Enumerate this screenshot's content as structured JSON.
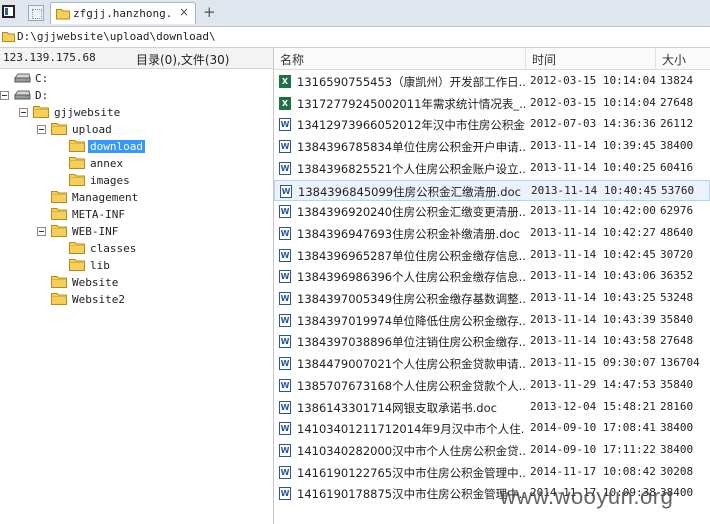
{
  "tab": {
    "title": "zfgjj.hanzhong.go...",
    "close": "×",
    "new": "+"
  },
  "address": {
    "path": "D:\\gjjwebsite\\upload\\download\\"
  },
  "status": {
    "ip": "123.139.175.68",
    "counts": "目录(0),文件(30)"
  },
  "tree": [
    {
      "label": "C:",
      "icon": "drive-icon",
      "toggle": false,
      "depth": 0
    },
    {
      "label": "D:",
      "icon": "drive-icon",
      "toggle": true,
      "depth": 0
    },
    {
      "label": "gjjwebsite",
      "icon": "folder-icon",
      "toggle": true,
      "depth": 1
    },
    {
      "label": "upload",
      "icon": "folder-icon",
      "toggle": true,
      "depth": 2
    },
    {
      "label": "download",
      "icon": "folder-icon",
      "toggle": false,
      "depth": 3,
      "selected": true
    },
    {
      "label": "annex",
      "icon": "folder-icon",
      "toggle": false,
      "depth": 3
    },
    {
      "label": "images",
      "icon": "folder-icon",
      "toggle": false,
      "depth": 3
    },
    {
      "label": "Management",
      "icon": "folder-icon",
      "toggle": false,
      "depth": 2
    },
    {
      "label": "META-INF",
      "icon": "folder-icon",
      "toggle": false,
      "depth": 2
    },
    {
      "label": "WEB-INF",
      "icon": "folder-icon",
      "toggle": true,
      "depth": 2
    },
    {
      "label": "classes",
      "icon": "folder-icon",
      "toggle": false,
      "depth": 3
    },
    {
      "label": "lib",
      "icon": "folder-icon",
      "toggle": false,
      "depth": 3
    },
    {
      "label": "Website",
      "icon": "folder-icon",
      "toggle": false,
      "depth": 2
    },
    {
      "label": "Website2",
      "icon": "folder-icon",
      "toggle": false,
      "depth": 2
    }
  ],
  "list": {
    "headers": {
      "name": "名称",
      "time": "时间",
      "size": "大小"
    },
    "files": [
      {
        "icon": "excel-icon",
        "name": "1316590755453（康凯州）开发部工作日...",
        "time": "2012-03-15 10:14:04",
        "size": "13824"
      },
      {
        "icon": "excel-icon",
        "name": "13172779245002011年需求统计情况表_...",
        "time": "2012-03-15 10:14:04",
        "size": "27648"
      },
      {
        "icon": "word-icon",
        "name": "13412973966052012年汉中市住房公积金...",
        "time": "2012-07-03 14:36:36",
        "size": "26112"
      },
      {
        "icon": "word-icon",
        "name": "1384396785834单位住房公积金开户申请...",
        "time": "2013-11-14 10:39:45",
        "size": "38400"
      },
      {
        "icon": "word-icon",
        "name": "1384396825521个人住房公积金账户设立...",
        "time": "2013-11-14 10:40:25",
        "size": "60416"
      },
      {
        "icon": "word-icon",
        "name": "1384396845099住房公积金汇缴清册.doc",
        "time": "2013-11-14 10:40:45",
        "size": "53760",
        "selected": true
      },
      {
        "icon": "word-icon",
        "name": "1384396920240住房公积金汇缴变更清册...",
        "time": "2013-11-14 10:42:00",
        "size": "62976"
      },
      {
        "icon": "word-icon",
        "name": "1384396947693住房公积金补缴清册.doc",
        "time": "2013-11-14 10:42:27",
        "size": "48640"
      },
      {
        "icon": "word-icon",
        "name": "1384396965287单位住房公积金缴存信息...",
        "time": "2013-11-14 10:42:45",
        "size": "30720"
      },
      {
        "icon": "word-icon",
        "name": "1384396986396个人住房公积金缴存信息...",
        "time": "2013-11-14 10:43:06",
        "size": "36352"
      },
      {
        "icon": "word-icon",
        "name": "1384397005349住房公积金缴存基数调整...",
        "time": "2013-11-14 10:43:25",
        "size": "53248"
      },
      {
        "icon": "word-icon",
        "name": "1384397019974单位降低住房公积金缴存...",
        "time": "2013-11-14 10:43:39",
        "size": "35840"
      },
      {
        "icon": "word-icon",
        "name": "1384397038896单位注销住房公积金缴存...",
        "time": "2013-11-14 10:43:58",
        "size": "27648"
      },
      {
        "icon": "word-icon",
        "name": "1384479007021个人住房公积金贷款申请...",
        "time": "2013-11-15 09:30:07",
        "size": "136704"
      },
      {
        "icon": "word-icon",
        "name": "1385707673168个人住房公积金贷款个人...",
        "time": "2013-11-29 14:47:53",
        "size": "35840"
      },
      {
        "icon": "word-icon",
        "name": "1386143301714网银支取承诺书.doc",
        "time": "2013-12-04 15:48:21",
        "size": "28160"
      },
      {
        "icon": "word-icon",
        "name": "14103401211712014年9月汉中市个人住...",
        "time": "2014-09-10 17:08:41",
        "size": "38400"
      },
      {
        "icon": "word-icon",
        "name": "1410340282000汉中市个人住房公积金贷...",
        "time": "2014-09-10 17:11:22",
        "size": "38400"
      },
      {
        "icon": "word-icon",
        "name": "1416190122765汉中市住房公积金管理中...",
        "time": "2014-11-17 10:08:42",
        "size": "30208"
      },
      {
        "icon": "word-icon",
        "name": "1416190178875汉中市住房公积金管理中...",
        "time": "2014-11-17 10:09:38",
        "size": "38400"
      }
    ]
  },
  "watermark": "www.wooyun.org"
}
